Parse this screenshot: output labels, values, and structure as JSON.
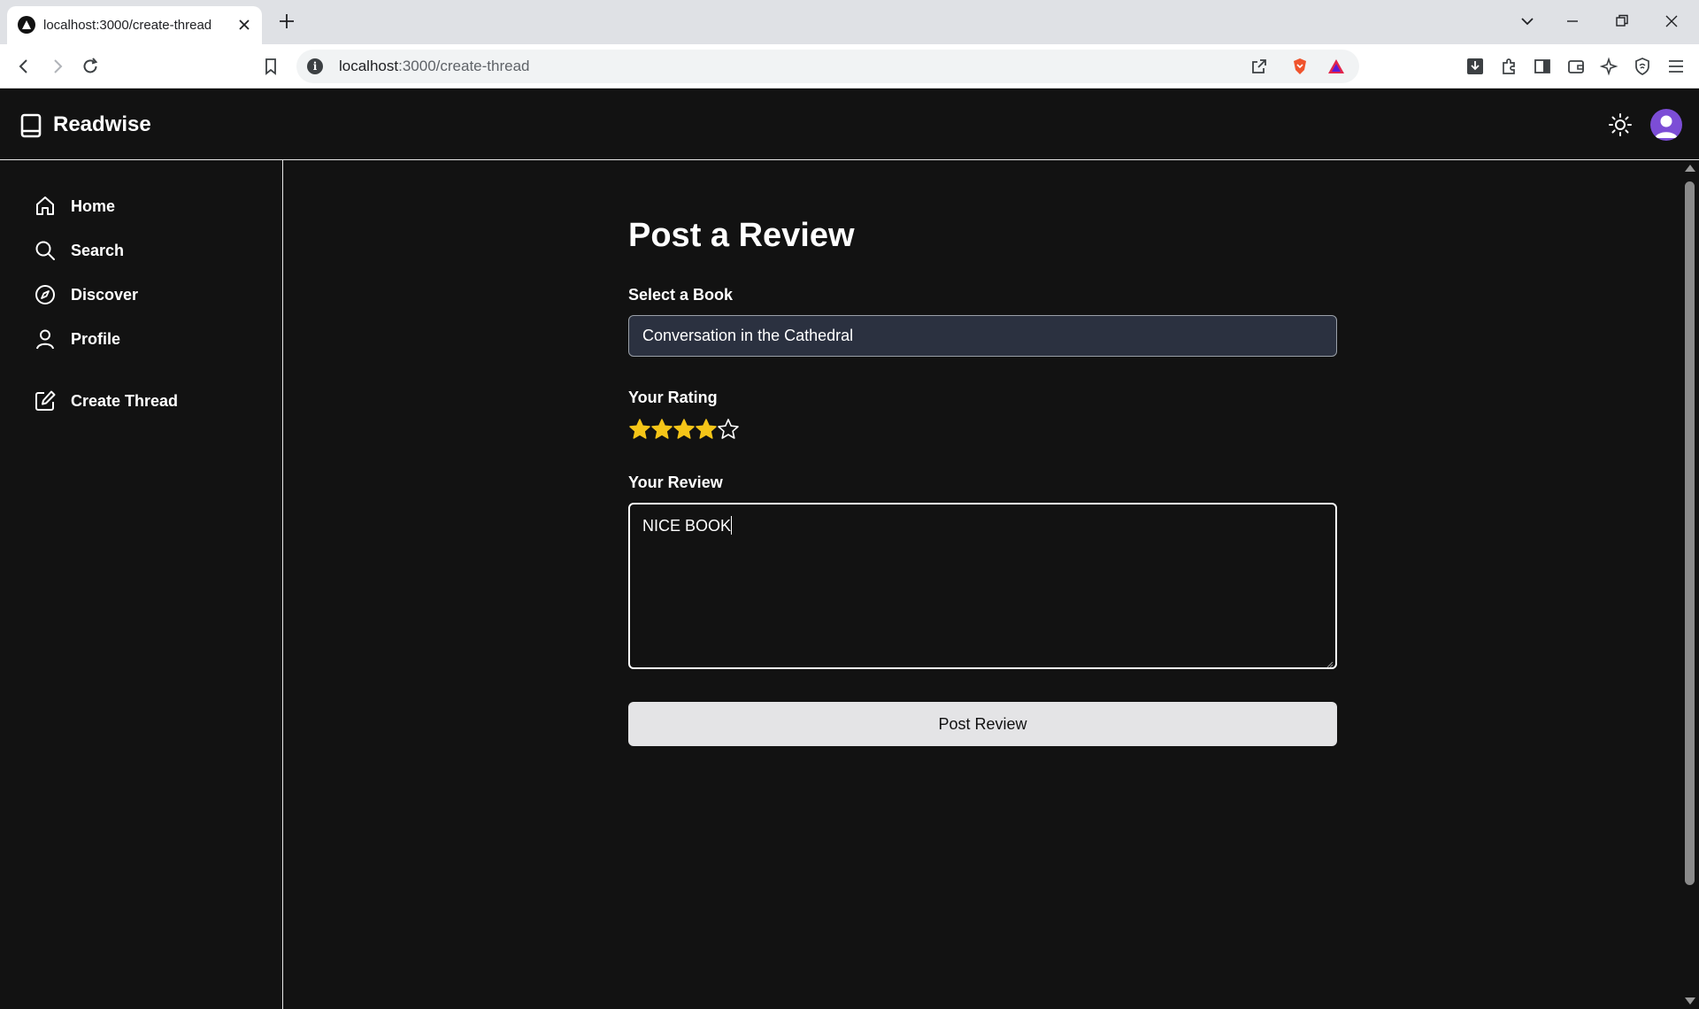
{
  "browser": {
    "tab_title": "localhost:3000/create-thread",
    "url_host": "localhost",
    "url_rest": ":3000/create-thread"
  },
  "app": {
    "brand": "Readwise"
  },
  "sidebar": {
    "items": [
      {
        "label": "Home",
        "icon": "home-icon"
      },
      {
        "label": "Search",
        "icon": "search-icon"
      },
      {
        "label": "Discover",
        "icon": "compass-icon"
      },
      {
        "label": "Profile",
        "icon": "user-icon"
      },
      {
        "label": "Create Thread",
        "icon": "edit-icon"
      }
    ]
  },
  "form": {
    "title": "Post a Review",
    "book_label": "Select a Book",
    "book_value": "Conversation in the Cathedral",
    "rating_label": "Your Rating",
    "rating": 4,
    "rating_max": 5,
    "review_label": "Your Review",
    "review_value": "NICE BOOK",
    "submit_label": "Post Review"
  },
  "colors": {
    "background": "#121212",
    "star_filled": "#f5c518",
    "select_bg": "#2b3140",
    "button_bg": "#e4e4e6",
    "avatar": "#7c4dd6"
  }
}
